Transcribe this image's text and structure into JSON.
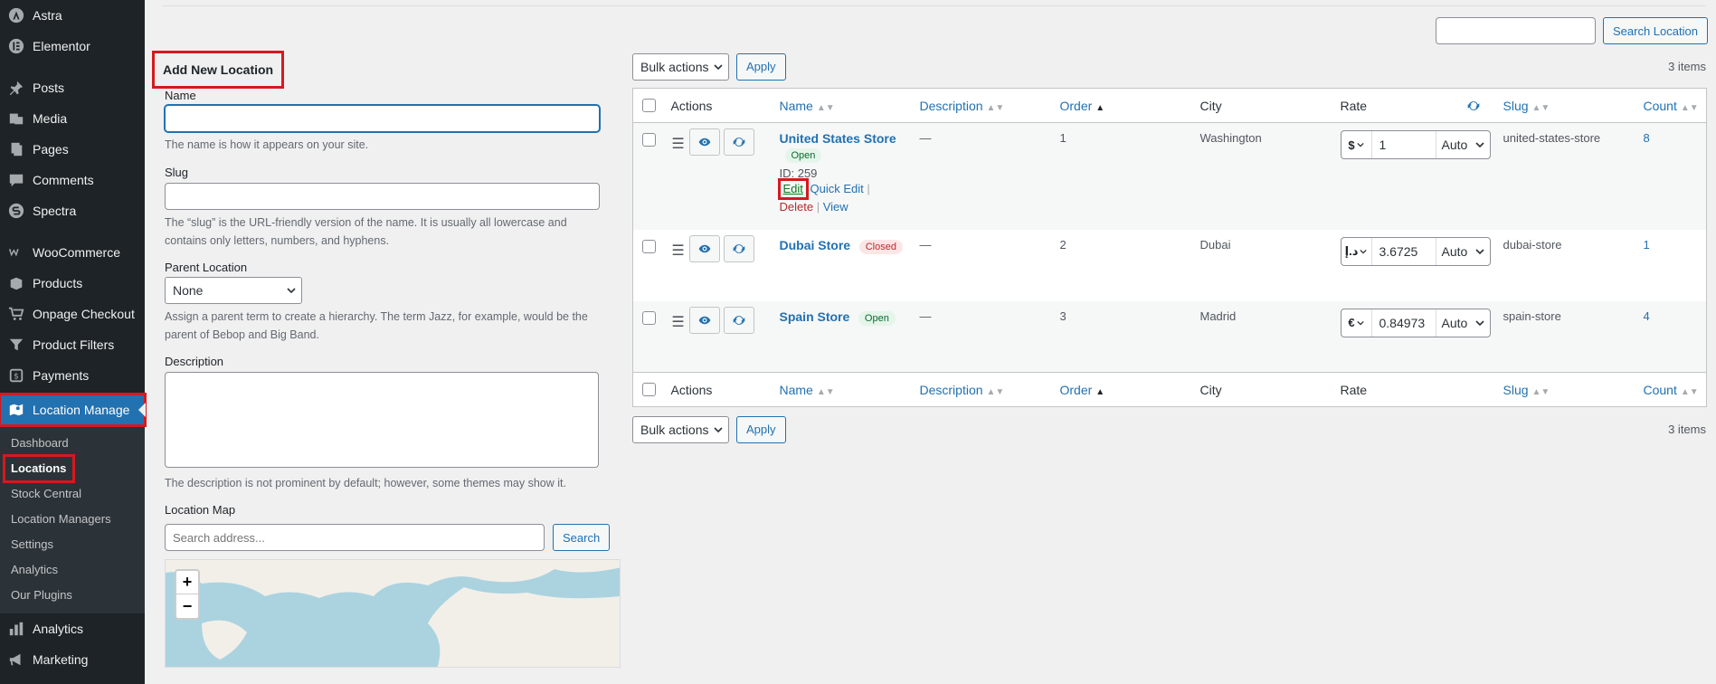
{
  "sidebar": {
    "top_items": [
      {
        "label": "Astra",
        "icon": "astra-icon"
      },
      {
        "label": "Elementor",
        "icon": "elementor-icon"
      }
    ],
    "items": [
      {
        "label": "Posts",
        "icon": "pin-icon"
      },
      {
        "label": "Media",
        "icon": "media-icon"
      },
      {
        "label": "Pages",
        "icon": "pages-icon"
      },
      {
        "label": "Comments",
        "icon": "comments-icon"
      },
      {
        "label": "Spectra",
        "icon": "spectra-icon"
      }
    ],
    "shop_items": [
      {
        "label": "WooCommerce",
        "icon": "woo-icon"
      },
      {
        "label": "Products",
        "icon": "products-icon"
      },
      {
        "label": "Onpage Checkout",
        "icon": "cart-icon"
      },
      {
        "label": "Product Filters",
        "icon": "filter-icon"
      },
      {
        "label": "Payments",
        "icon": "payments-icon"
      }
    ],
    "active": {
      "label": "Location Manage",
      "icon": "location-icon"
    },
    "submenu": [
      "Dashboard",
      "Locations",
      "Stock Central",
      "Location Managers",
      "Settings",
      "Analytics",
      "Our Plugins"
    ],
    "bottom_items": [
      {
        "label": "Analytics",
        "icon": "analytics-icon"
      },
      {
        "label": "Marketing",
        "icon": "megaphone-icon"
      }
    ]
  },
  "search": {
    "button_label": "Search Location",
    "value": ""
  },
  "form": {
    "title": "Add New Location",
    "name_label": "Name",
    "name_help": "The name is how it appears on your site.",
    "slug_label": "Slug",
    "slug_help": "The “slug” is the URL-friendly version of the name. It is usually all lowercase and contains only letters, numbers, and hyphens.",
    "parent_label": "Parent Location",
    "parent_value": "None",
    "parent_help": "Assign a parent term to create a hierarchy. The term Jazz, for example, would be the parent of Bebop and Big Band.",
    "description_label": "Description",
    "description_help": "The description is not prominent by default; however, some themes may show it.",
    "map_label": "Location Map",
    "map_search_placeholder": "Search address...",
    "map_search_button": "Search",
    "zoom_in": "+",
    "zoom_out": "−"
  },
  "list": {
    "bulk_label": "Bulk actions",
    "apply_label": "Apply",
    "items_count": "3 items",
    "columns": {
      "actions": "Actions",
      "name": "Name",
      "description": "Description",
      "order": "Order",
      "city": "City",
      "rate": "Rate",
      "slug": "Slug",
      "count": "Count"
    },
    "rows": [
      {
        "name": "United States Store",
        "status": "Open",
        "id_text": "ID: 259",
        "description": "—",
        "order": "1",
        "city": "Washington",
        "currency": "$",
        "rate": "1",
        "mode": "Auto",
        "slug": "united-states-store",
        "count": "8"
      },
      {
        "name": "Dubai Store",
        "status": "Closed",
        "description": "—",
        "order": "2",
        "city": "Dubai",
        "currency": "د.إ",
        "rate": "3.6725",
        "mode": "Auto",
        "slug": "dubai-store",
        "count": "1"
      },
      {
        "name": "Spain Store",
        "status": "Open",
        "description": "—",
        "order": "3",
        "city": "Madrid",
        "currency": "€",
        "rate": "0.84973",
        "mode": "Auto",
        "slug": "spain-store",
        "count": "4"
      }
    ],
    "row_actions": {
      "edit": "Edit",
      "quick_edit": "Quick Edit",
      "delete": "Delete",
      "view": "View",
      "sep": "|"
    }
  }
}
